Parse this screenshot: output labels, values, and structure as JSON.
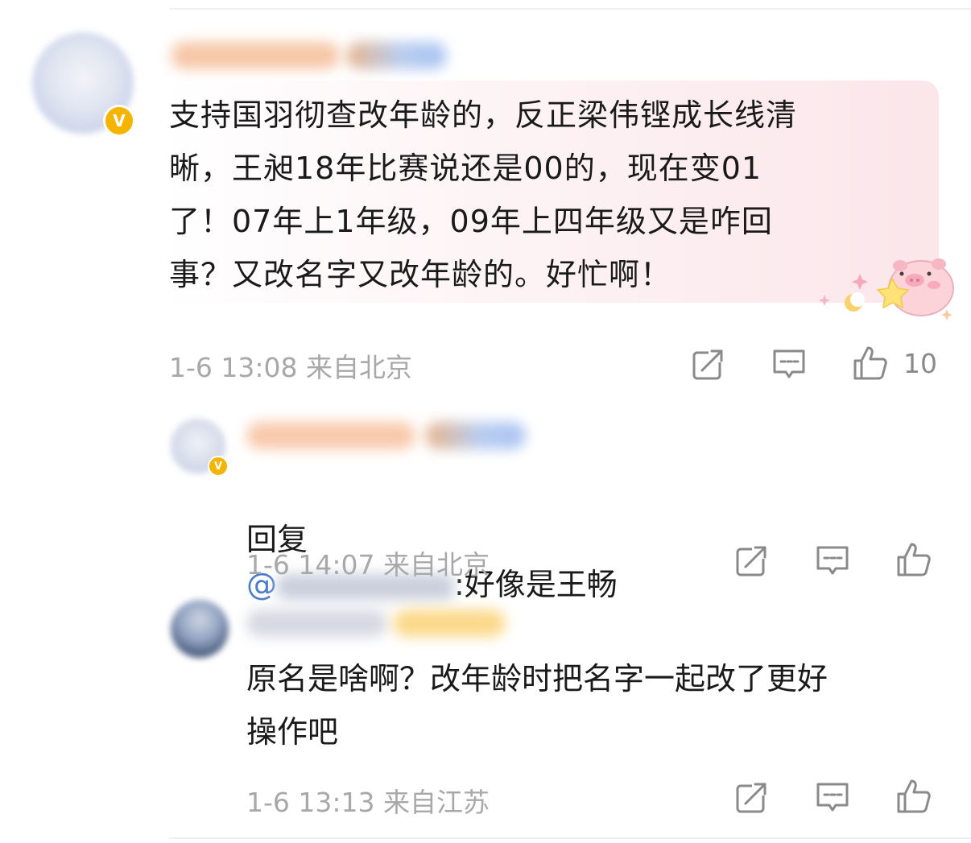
{
  "comment": {
    "username": "",
    "text": "支持国羽彻查改年龄的，反正梁伟铿成长线清\n晰，王昶18年比赛说还是00的，现在变01\n了！07年上1年级，09年上四年级又是咋回\n事？又改名字又改年龄的。好忙啊！",
    "time": "1-6 13:08",
    "location": "来自北京",
    "like_count": "10"
  },
  "replies": [
    {
      "username": "",
      "reply_prefix": "回复",
      "mention_at": "@",
      "text": ":好像是王畅",
      "time": "1-6 14:07",
      "location": "来自北京",
      "like_count": ""
    },
    {
      "username": "",
      "text": "原名是啥啊？改年龄时把名字一起改了更好\n操作吧",
      "time": "1-6 13:13",
      "location": "来自江苏",
      "like_count": ""
    }
  ],
  "badges": {
    "verified": "V"
  },
  "icons": {
    "share": "share-icon",
    "comment": "comment-icon",
    "like": "thumbs-up-icon"
  },
  "colors": {
    "meta_text": "#a8a8a8",
    "mention": "#4a7cc9",
    "verified_badge": "#f5b400",
    "bubble_pink": "#fbe6ea"
  }
}
